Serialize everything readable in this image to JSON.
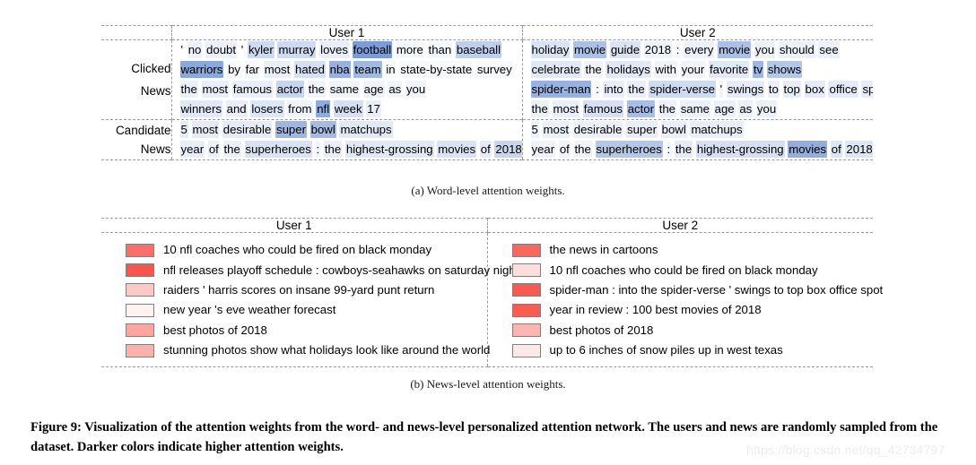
{
  "figure": {
    "main_caption": "Figure 9: Visualization of the attention weights from the word- and news-level personalized attention network. The users and news are randomly sampled from the dataset. Darker colors indicate higher attention weights.",
    "watermark": "https://blog.csdn.net/qq_42734797",
    "subcaption_a": "(a)  Word-level attention weights.",
    "subcaption_b": "(b)  News-level attention weights."
  },
  "colors": {
    "word_highlight_base": "#4472c4",
    "news_swatch_base": "#f8463c",
    "grid_dash": "#9a9a9a"
  },
  "word_level": {
    "headers": {
      "blank": "",
      "user1": "User 1",
      "user2": "User 2"
    },
    "row_labels": {
      "clicked_line1": "Clicked",
      "clicked_line2": "News",
      "candidate_line1": "Candidate",
      "candidate_line2": "News"
    },
    "user1": {
      "clicked_news": [
        [
          {
            "t": "'",
            "w": 0.0
          },
          {
            "t": "no",
            "w": 0.1
          },
          {
            "t": "doubt",
            "w": 0.1
          },
          {
            "t": "'",
            "w": 0.0
          },
          {
            "t": "kyler",
            "w": 0.26
          },
          {
            "t": "murray",
            "w": 0.26
          },
          {
            "t": "loves",
            "w": 0.12
          },
          {
            "t": "football",
            "w": 0.7
          },
          {
            "t": "more",
            "w": 0.06
          },
          {
            "t": "than",
            "w": 0.06
          },
          {
            "t": "baseball",
            "w": 0.34
          }
        ],
        [
          {
            "t": "warriors",
            "w": 0.62
          },
          {
            "t": "by",
            "w": 0.05
          },
          {
            "t": "far",
            "w": 0.05
          },
          {
            "t": "most",
            "w": 0.12
          },
          {
            "t": "hated",
            "w": 0.22
          },
          {
            "t": "nba",
            "w": 0.55
          },
          {
            "t": "team",
            "w": 0.5
          },
          {
            "t": "in",
            "w": 0.04
          },
          {
            "t": "state-by-state",
            "w": 0.04
          },
          {
            "t": "survey",
            "w": 0.04
          }
        ],
        [
          {
            "t": "the",
            "w": 0.1
          },
          {
            "t": "most",
            "w": 0.12
          },
          {
            "t": "famous",
            "w": 0.12
          },
          {
            "t": "actor",
            "w": 0.3
          },
          {
            "t": "the",
            "w": 0.08
          },
          {
            "t": "same",
            "w": 0.08
          },
          {
            "t": "age",
            "w": 0.08
          },
          {
            "t": "as",
            "w": 0.08
          },
          {
            "t": "you",
            "w": 0.08
          }
        ],
        [
          {
            "t": "winners",
            "w": 0.16
          },
          {
            "t": "and",
            "w": 0.12
          },
          {
            "t": "losers",
            "w": 0.18
          },
          {
            "t": "from",
            "w": 0.08
          },
          {
            "t": "nfl",
            "w": 0.6
          },
          {
            "t": "week",
            "w": 0.22
          },
          {
            "t": "17",
            "w": 0.12
          }
        ]
      ],
      "candidate_news": [
        [
          {
            "t": "5",
            "w": 0.14
          },
          {
            "t": "most",
            "w": 0.14
          },
          {
            "t": "desirable",
            "w": 0.14
          },
          {
            "t": "super",
            "w": 0.52
          },
          {
            "t": "bowl",
            "w": 0.48
          },
          {
            "t": "matchups",
            "w": 0.16
          }
        ],
        [
          {
            "t": "year",
            "w": 0.12
          },
          {
            "t": "of",
            "w": 0.1
          },
          {
            "t": "the",
            "w": 0.1
          },
          {
            "t": "superheroes",
            "w": 0.2
          },
          {
            "t": ":",
            "w": 0.08
          },
          {
            "t": "the",
            "w": 0.12
          },
          {
            "t": "highest-grossing",
            "w": 0.16
          },
          {
            "t": "movies",
            "w": 0.2
          },
          {
            "t": "of",
            "w": 0.14
          },
          {
            "t": "2018",
            "w": 0.3
          }
        ]
      ]
    },
    "user2": {
      "clicked_news": [
        [
          {
            "t": "holiday",
            "w": 0.2
          },
          {
            "t": "movie",
            "w": 0.45
          },
          {
            "t": "guide",
            "w": 0.2
          },
          {
            "t": "2018",
            "w": 0.08
          },
          {
            "t": ":",
            "w": 0.06
          },
          {
            "t": "every",
            "w": 0.1
          },
          {
            "t": "movie",
            "w": 0.45
          },
          {
            "t": "you",
            "w": 0.1
          },
          {
            "t": "should",
            "w": 0.1
          },
          {
            "t": "see",
            "w": 0.1
          }
        ],
        [
          {
            "t": "celebrate",
            "w": 0.16
          },
          {
            "t": "the",
            "w": 0.08
          },
          {
            "t": "holidays",
            "w": 0.16
          },
          {
            "t": "with",
            "w": 0.08
          },
          {
            "t": "your",
            "w": 0.08
          },
          {
            "t": "favorite",
            "w": 0.16
          },
          {
            "t": "tv",
            "w": 0.52
          },
          {
            "t": "shows",
            "w": 0.4
          }
        ],
        [
          {
            "t": "spider-man",
            "w": 0.55
          },
          {
            "t": ":",
            "w": 0.06
          },
          {
            "t": "into",
            "w": 0.12
          },
          {
            "t": "the",
            "w": 0.12
          },
          {
            "t": "spider-verse",
            "w": 0.26
          },
          {
            "t": "'",
            "w": 0.08
          },
          {
            "t": "swings",
            "w": 0.14
          },
          {
            "t": "to",
            "w": 0.12
          },
          {
            "t": "top",
            "w": 0.14
          },
          {
            "t": "box",
            "w": 0.14
          },
          {
            "t": "office",
            "w": 0.14
          },
          {
            "t": "spot",
            "w": 0.14
          }
        ],
        [
          {
            "t": "the",
            "w": 0.1
          },
          {
            "t": "most",
            "w": 0.12
          },
          {
            "t": "famous",
            "w": 0.22
          },
          {
            "t": "actor",
            "w": 0.46
          },
          {
            "t": "the",
            "w": 0.1
          },
          {
            "t": "same",
            "w": 0.1
          },
          {
            "t": "age",
            "w": 0.1
          },
          {
            "t": "as",
            "w": 0.1
          },
          {
            "t": "you",
            "w": 0.1
          }
        ]
      ],
      "candidate_news": [
        [
          {
            "t": "5",
            "w": 0.1
          },
          {
            "t": "most",
            "w": 0.1
          },
          {
            "t": "desirable",
            "w": 0.1
          },
          {
            "t": "super",
            "w": 0.12
          },
          {
            "t": "bowl",
            "w": 0.12
          },
          {
            "t": "matchups",
            "w": 0.12
          }
        ],
        [
          {
            "t": "year",
            "w": 0.08
          },
          {
            "t": "of",
            "w": 0.08
          },
          {
            "t": "the",
            "w": 0.08
          },
          {
            "t": "superheroes",
            "w": 0.4
          },
          {
            "t": ":",
            "w": 0.06
          },
          {
            "t": "the",
            "w": 0.14
          },
          {
            "t": "highest-grossing",
            "w": 0.22
          },
          {
            "t": "movies",
            "w": 0.58
          },
          {
            "t": "of",
            "w": 0.18
          },
          {
            "t": "2018",
            "w": 0.18
          }
        ]
      ]
    }
  },
  "news_level": {
    "headers": {
      "user1": "User 1",
      "user2": "User 2"
    },
    "user1": [
      {
        "text": "10 nfl coaches who could be fired on black monday",
        "w": 0.78
      },
      {
        "text": "nfl releases playoff schedule : cowboys-seahawks on saturday night",
        "w": 0.92
      },
      {
        "text": "raiders ' harris scores on insane 99-yard punt return",
        "w": 0.3
      },
      {
        "text": "new year 's eve weather forecast",
        "w": 0.07
      },
      {
        "text": "best photos of 2018",
        "w": 0.48
      },
      {
        "text": "stunning photos show what holidays look like around the world",
        "w": 0.42
      }
    ],
    "user2": [
      {
        "text": "the news in cartoons",
        "w": 0.82
      },
      {
        "text": "10 nfl coaches who could be fired on black monday",
        "w": 0.18
      },
      {
        "text": "spider-man : into the spider-verse ' swings to top box office spot",
        "w": 0.9
      },
      {
        "text": "year in review : 100 best movies of 2018",
        "w": 0.88
      },
      {
        "text": "best photos of 2018",
        "w": 0.4
      },
      {
        "text": "up to 6 inches of snow piles up in west texas",
        "w": 0.12
      }
    ]
  }
}
